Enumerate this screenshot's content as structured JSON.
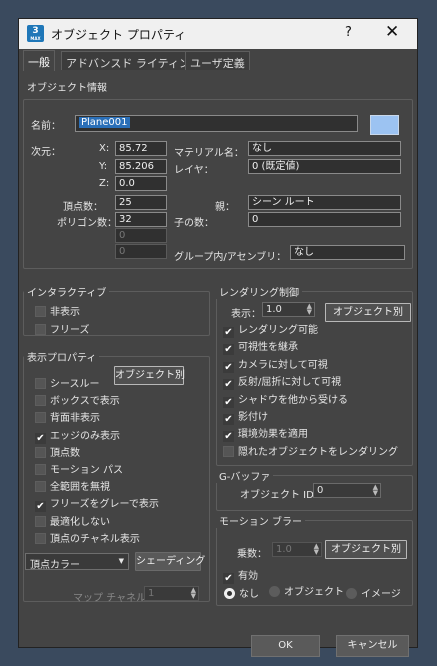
{
  "window": {
    "title": "オブジェクト プロパティ",
    "app_icon_text": "3",
    "app_icon_sub": "MAX",
    "help": "?",
    "close": "✕"
  },
  "tabs": [
    "一般",
    "アドバンスド ライティング",
    "ユーザ定義"
  ],
  "object_info": {
    "title": "オブジェクト情報",
    "name_label": "名前：",
    "name_value": "Plane001",
    "color": "#9cc3f2",
    "dimensions_label": "次元：",
    "x_label": "X:",
    "x_value": "85.72",
    "y_label": "Y:",
    "y_value": "85.206",
    "z_label": "Z:",
    "z_value": "0.0",
    "material_label": "マテリアル名：",
    "material_value": "なし",
    "layer_label": "レイヤ：",
    "layer_value": "0 (既定値)",
    "vertices_label": "頂点数：",
    "vertices_value": "25",
    "faces_label": "ポリゴン数：",
    "faces_value": "32",
    "blank1": "0",
    "blank2": "0",
    "parent_label": "親：",
    "parent_value": "シーン ルート",
    "children_label": "子の数：",
    "children_value": "0",
    "group_label": "グループ内/アセンブリ：",
    "group_value": "なし"
  },
  "interactivity": {
    "title": "インタラクティブ",
    "hide": "非表示",
    "freeze": "フリーズ"
  },
  "display_props": {
    "title": "表示プロパティ",
    "by_object_button": "オブジェクト別",
    "items": [
      {
        "label": "シースルー",
        "checked": false
      },
      {
        "label": "ボックスで表示",
        "checked": false
      },
      {
        "label": "背面非表示",
        "checked": false
      },
      {
        "label": "エッジのみ表示",
        "checked": true
      },
      {
        "label": "頂点数",
        "checked": false
      },
      {
        "label": "モーション パス",
        "checked": false
      },
      {
        "label": "全範囲を無視",
        "checked": false
      },
      {
        "label": "フリーズをグレーで表示",
        "checked": true
      },
      {
        "label": "最適化しない",
        "checked": false
      },
      {
        "label": "頂点のチャネル表示",
        "checked": false
      }
    ],
    "vertex_color_dropdown": "頂点カラー",
    "shading_button": "シェーディング",
    "map_channel_label": "マップ チャネル：",
    "map_channel_value": "1"
  },
  "rendering": {
    "title": "レンダリング制御",
    "visibility_label": "表示：",
    "visibility_value": "1.0",
    "by_object_button": "オブジェクト別",
    "items": [
      {
        "label": "レンダリング可能",
        "checked": true
      },
      {
        "label": "可視性を継承",
        "checked": true
      },
      {
        "label": "カメラに対して可視",
        "checked": true
      },
      {
        "label": "反射/屈折に対して可視",
        "checked": true
      },
      {
        "label": "シャドウを他から受ける",
        "checked": true
      },
      {
        "label": "影付け",
        "checked": true
      },
      {
        "label": "環境効果を適用",
        "checked": true
      },
      {
        "label": "隠れたオブジェクトをレンダリング",
        "checked": false
      }
    ]
  },
  "gbuffer": {
    "title": "G-バッファ",
    "object_id_label": "オブジェクト ID：",
    "object_id_value": "0"
  },
  "motion_blur": {
    "title": "モーション ブラー",
    "multiplier_label": "乗数：",
    "multiplier_value": "1.0",
    "by_object_button": "オブジェクト別",
    "enabled_label": "有効",
    "radio_none": "なし",
    "radio_object": "オブジェクト",
    "radio_image": "イメージ"
  },
  "footer": {
    "ok": "OK",
    "cancel": "キャンセル"
  }
}
